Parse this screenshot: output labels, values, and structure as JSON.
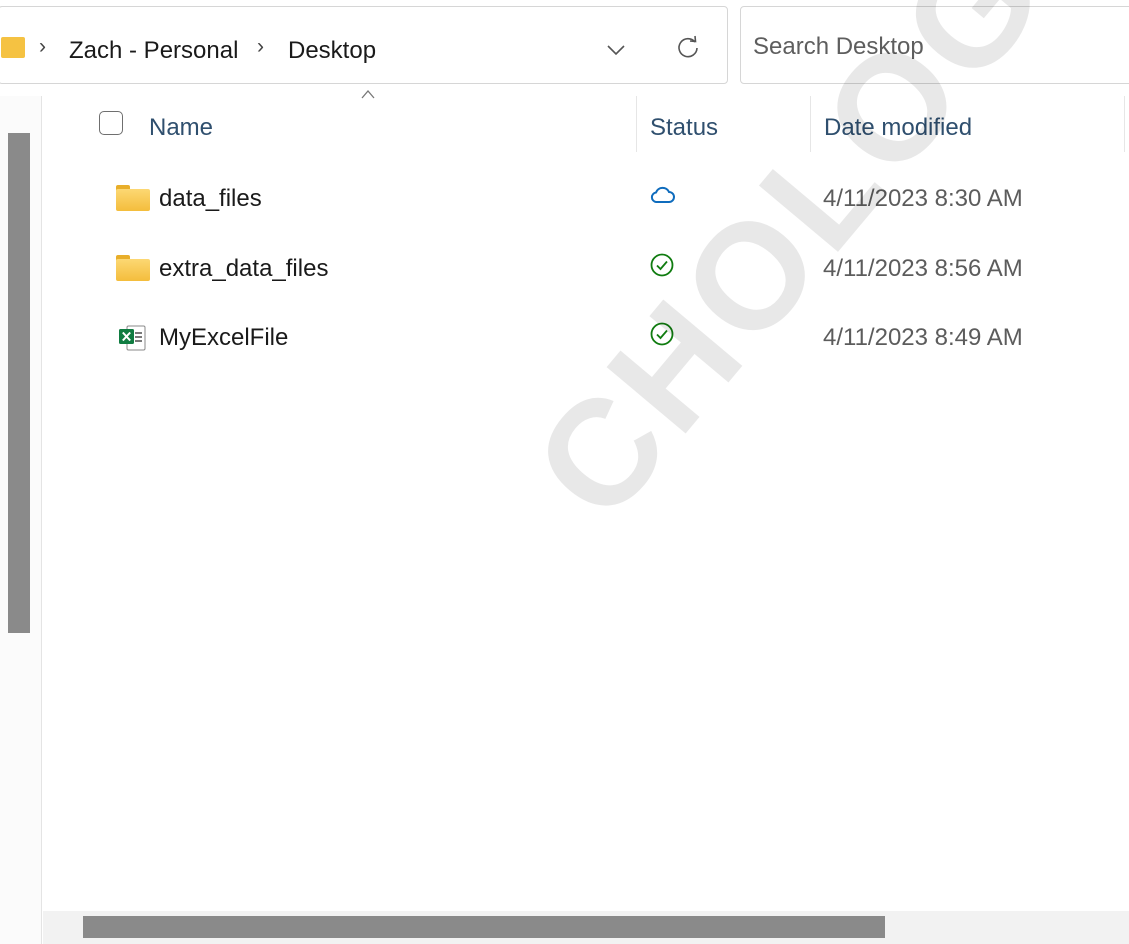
{
  "breadcrumb": {
    "items": [
      "Zach - Personal",
      "Desktop"
    ],
    "separator": "›"
  },
  "search": {
    "placeholder": "Search Desktop"
  },
  "columns": {
    "name": "Name",
    "status": "Status",
    "date": "Date modified"
  },
  "files": [
    {
      "name": "data_files",
      "type": "folder-icon",
      "status": "cloud-icon",
      "date": "4/11/2023 8:30 AM"
    },
    {
      "name": "extra_data_files",
      "type": "folder-icon",
      "status": "check-circle-icon",
      "date": "4/11/2023 8:56 AM"
    },
    {
      "name": "MyExcelFile",
      "type": "excel-file-icon",
      "status": "check-circle-icon",
      "date": "4/11/2023 8:49 AM"
    }
  ],
  "watermark": {
    "text": "CHOLOGY.CO"
  },
  "colors": {
    "folder": "#f5c242",
    "cloud_status": "#0f6cbd",
    "synced_status": "#107c10",
    "excel": "#107c41",
    "scrollbar": "#8a8a8a"
  }
}
